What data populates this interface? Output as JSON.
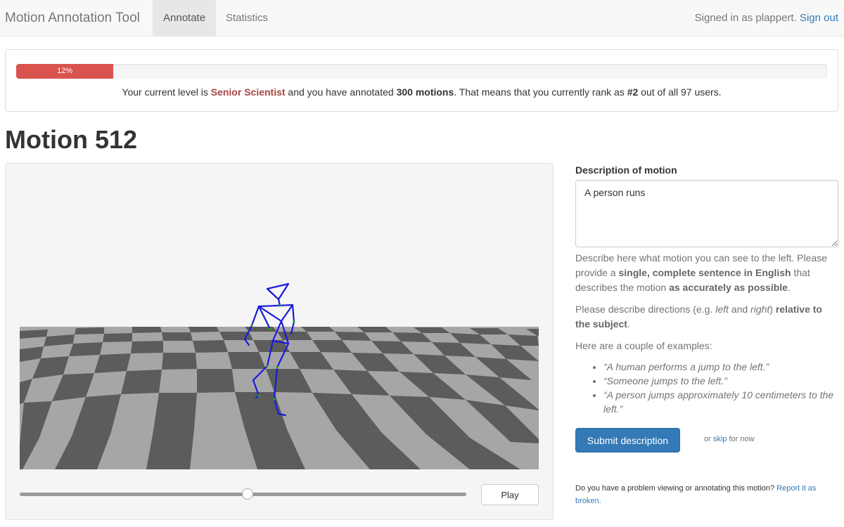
{
  "navbar": {
    "brand": "Motion Annotation Tool",
    "tabs": [
      {
        "label": "Annotate",
        "active": true
      },
      {
        "label": "Statistics",
        "active": false
      }
    ],
    "signed_in_prefix": "Signed in as plappert.",
    "sign_out": "Sign out"
  },
  "level_panel": {
    "progress_percent": 12,
    "progress_label": "12%",
    "progress_color": "#d9534f",
    "text_1": "Your current level is ",
    "level_name": "Senior Scientist",
    "text_2": " and you have annotated ",
    "annotated_count": "300 motions",
    "text_3": ". That means that you currently rank as ",
    "rank": "#2",
    "text_4": " out of all 97 users."
  },
  "page_title": "Motion 512",
  "viewer": {
    "play_label": "Play",
    "playback_position": 0.51
  },
  "description": {
    "label": "Description of motion",
    "value": "A person runs",
    "help_1a": "Describe here what motion you can see to the left. Please provide a ",
    "help_1b": "single, complete sentence in English",
    "help_1c": " that describes the motion ",
    "help_1d": "as accurately as possible",
    "help_1e": ".",
    "help_2a": "Please describe directions (e.g. ",
    "help_2b": "left",
    "help_2c": " and ",
    "help_2d": "right",
    "help_2e": ") ",
    "help_2f": "relative to the subject",
    "help_2g": ".",
    "examples_intro": "Here are a couple of examples:",
    "examples": [
      "“A human performs a jump to the left.”",
      "“Someone jumps to the left.”",
      "“A person jumps approximately 10 centimeters to the left.”"
    ],
    "submit_label": "Submit description",
    "skip_prefix": "or ",
    "skip_link": "skip",
    "skip_suffix": " for now",
    "report_text": "Do you have a problem viewing or annotating this motion? ",
    "report_link": "Report it as broken."
  }
}
